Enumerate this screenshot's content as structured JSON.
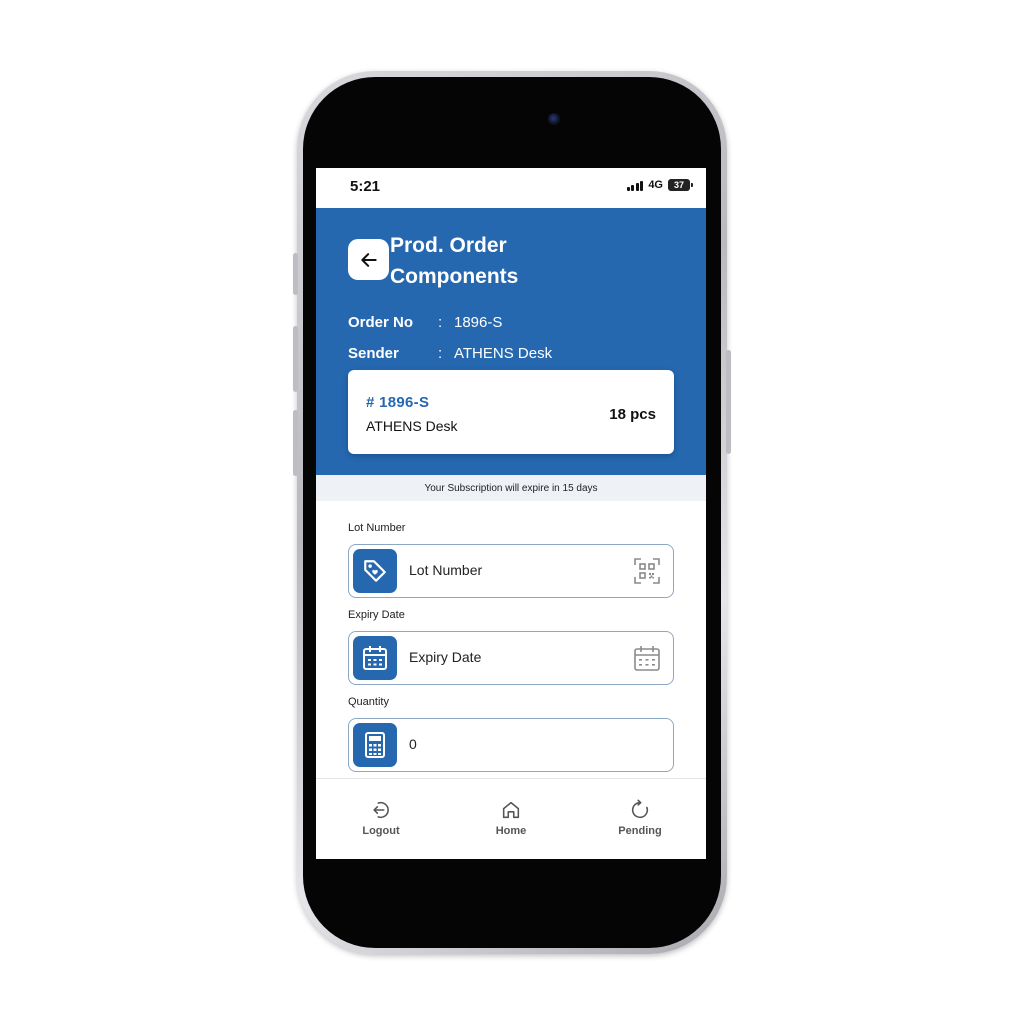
{
  "status_bar": {
    "time": "5:21",
    "network": "4G",
    "battery": "37"
  },
  "header": {
    "title_line1": "Prod. Order",
    "title_line2": "Components",
    "order_no_label": "Order No",
    "order_no_value": "1896-S",
    "sender_label": "Sender",
    "sender_value": "ATHENS Desk",
    "separator": ":"
  },
  "order_card": {
    "id": "# 1896-S",
    "name": "ATHENS Desk",
    "quantity": "18 pcs"
  },
  "subscription_banner": "Your Subscription will expire in 15 days",
  "form": {
    "lot_number": {
      "label": "Lot Number",
      "placeholder": "Lot Number",
      "icon": "tag-icon",
      "action_icon": "qr-scan-icon"
    },
    "expiry_date": {
      "label": "Expiry Date",
      "placeholder": "Expiry Date",
      "icon": "calendar-icon",
      "action_icon": "calendar-icon"
    },
    "quantity": {
      "label": "Quantity",
      "value": "0",
      "icon": "calculator-icon"
    }
  },
  "bottom_nav": {
    "items": [
      {
        "label": "Logout",
        "icon": "logout-icon"
      },
      {
        "label": "Home",
        "icon": "home-icon"
      },
      {
        "label": "Pending",
        "icon": "refresh-icon"
      }
    ]
  },
  "colors": {
    "primary": "#2568b0",
    "banner_bg": "#eef1f6",
    "field_border": "#8aa8c6"
  }
}
